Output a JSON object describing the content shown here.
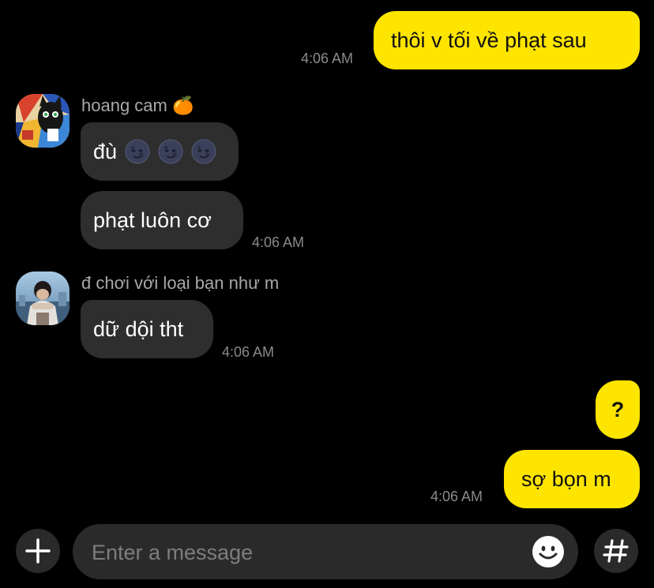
{
  "messages": {
    "m1": {
      "text": "thôi v tối về phạt sau",
      "time": "4:06 AM"
    },
    "group1": {
      "sender": "hoang cam",
      "sender_emoji": "🍊",
      "m2": {
        "text": "đù",
        "emoji": [
          "new-moon-face",
          "new-moon-face",
          "new-moon-face"
        ]
      },
      "m3": {
        "text": "phạt luôn cơ",
        "time": "4:06 AM"
      }
    },
    "group2": {
      "sender": "đ chơi với loại bạn như m",
      "m4": {
        "text": "dữ dội tht",
        "time": "4:06 AM"
      }
    },
    "m5": {
      "text": "?"
    },
    "m6": {
      "text": "sợ bọn m",
      "time": "4:06 AM"
    }
  },
  "composer": {
    "placeholder": "Enter a message",
    "value": ""
  },
  "icons": {
    "attach": "plus-icon",
    "emoticon": "smiley-icon",
    "hashtag": "hashtag-icon"
  },
  "colors": {
    "background": "#000000",
    "outgoing_bubble": "#fee500",
    "incoming_bubble": "#2e2e2e",
    "timestamp": "#8a8a8a"
  }
}
